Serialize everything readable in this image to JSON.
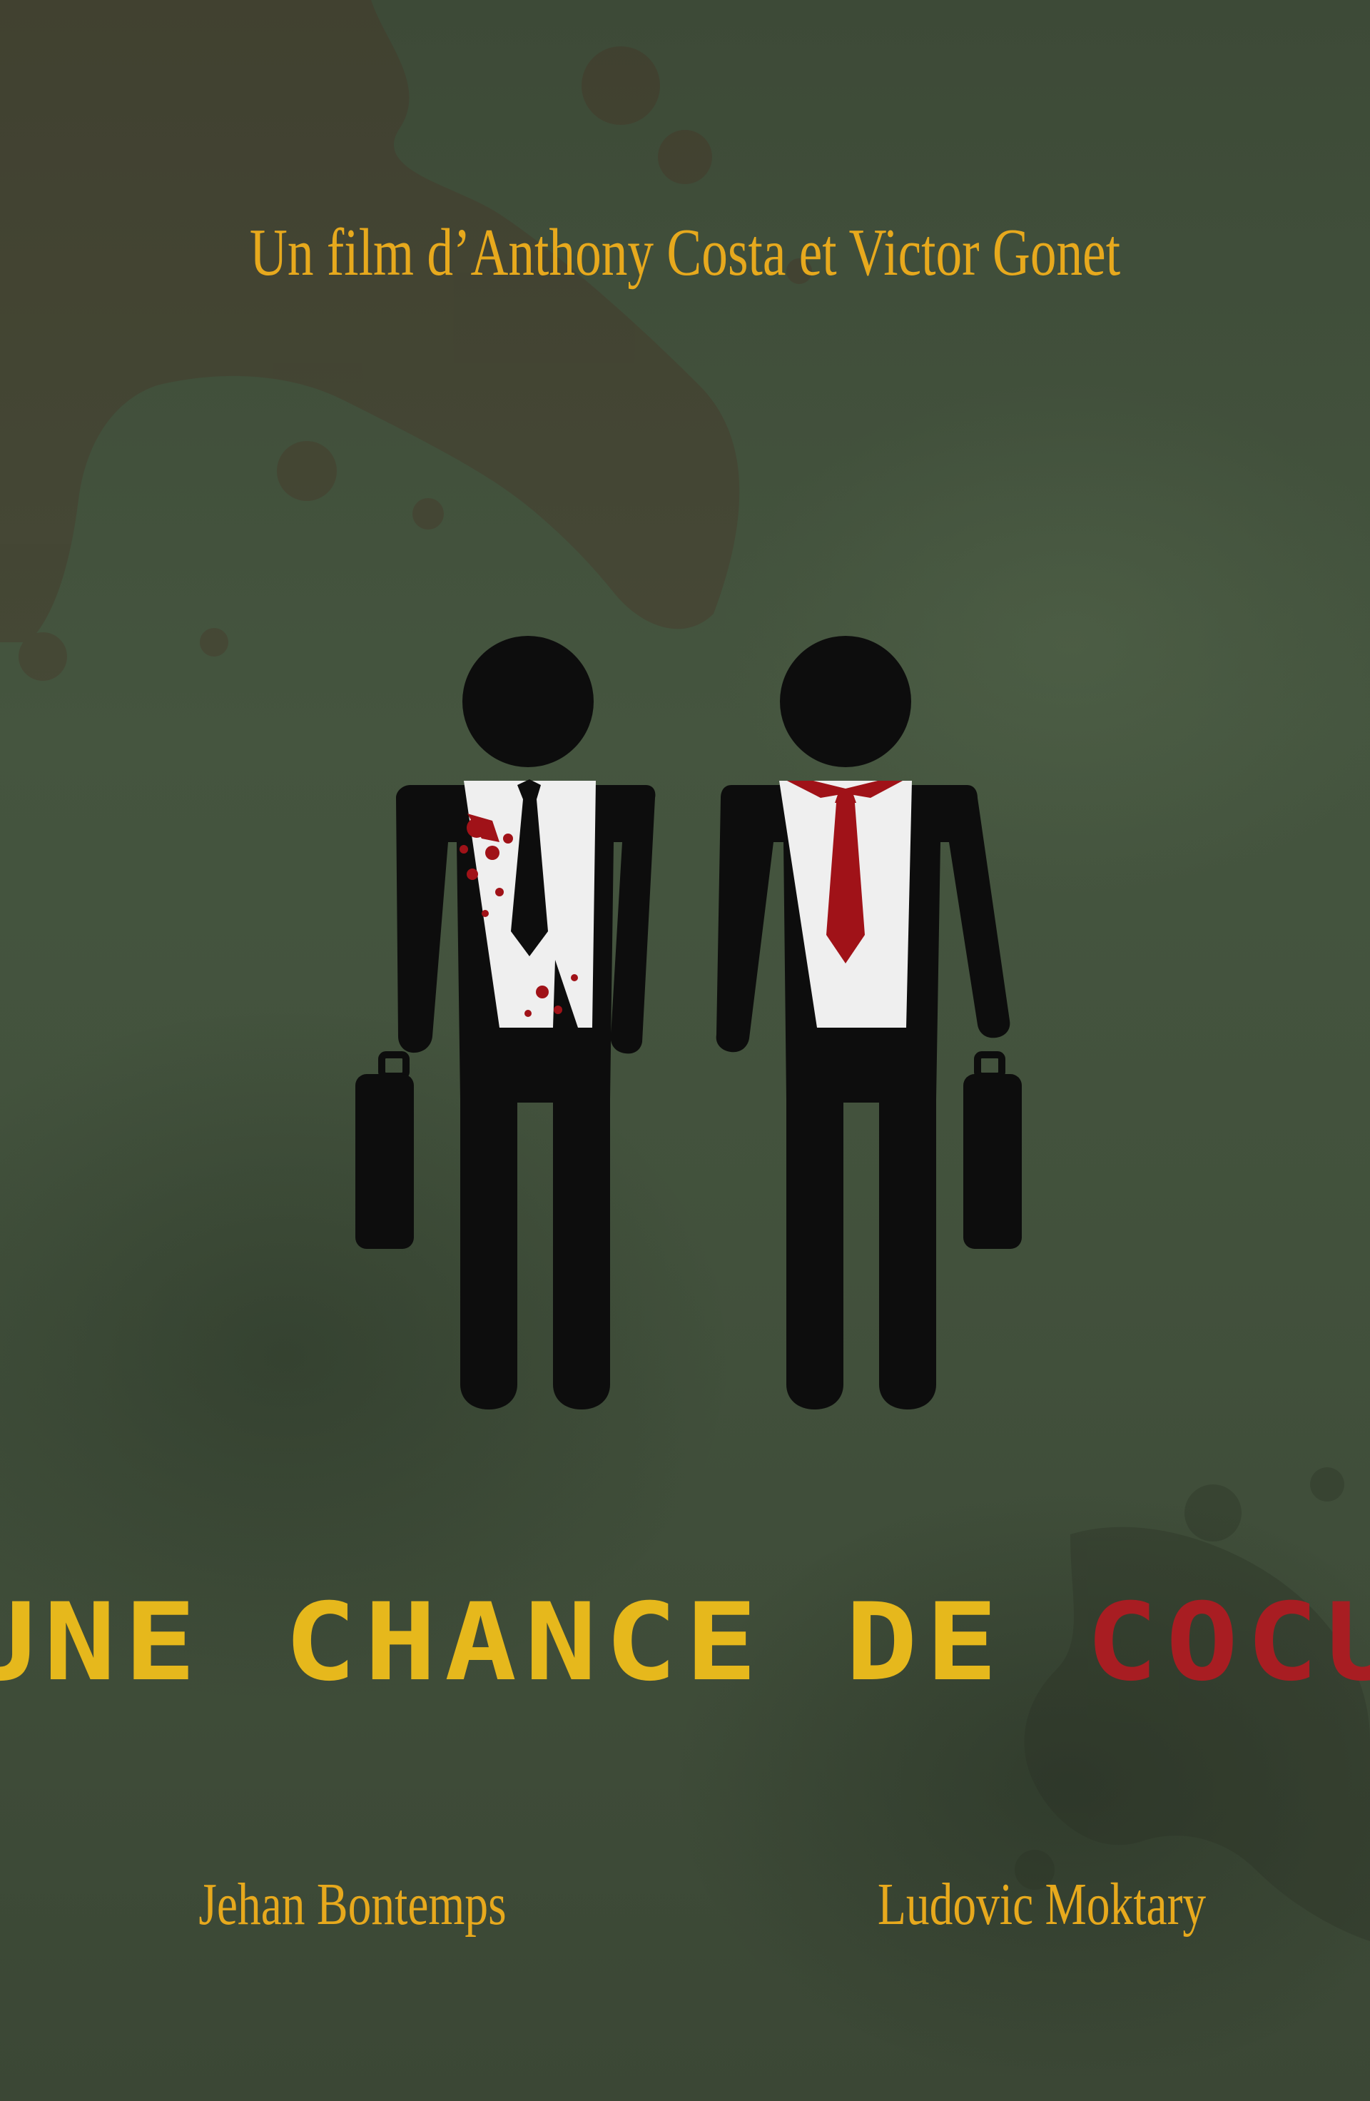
{
  "poster": {
    "credit_line": "Un film d’Anthony Costa et Victor Gonet",
    "title_main": "UNE CHANCE DE ",
    "title_accent": "COCU",
    "actor_left": "Jehan Bontemps",
    "actor_right": "Ludovic Moktary"
  },
  "colors": {
    "background": "#42513c",
    "text_gold": "#e7a91d",
    "title_red": "#a81d22",
    "figure_black": "#0d0d0d",
    "shirt_white": "#f2f2f2",
    "blood_red": "#a01218"
  },
  "icons": [
    "blood-splatter-icon",
    "figure-man-icon",
    "briefcase-icon",
    "tie-icon"
  ]
}
